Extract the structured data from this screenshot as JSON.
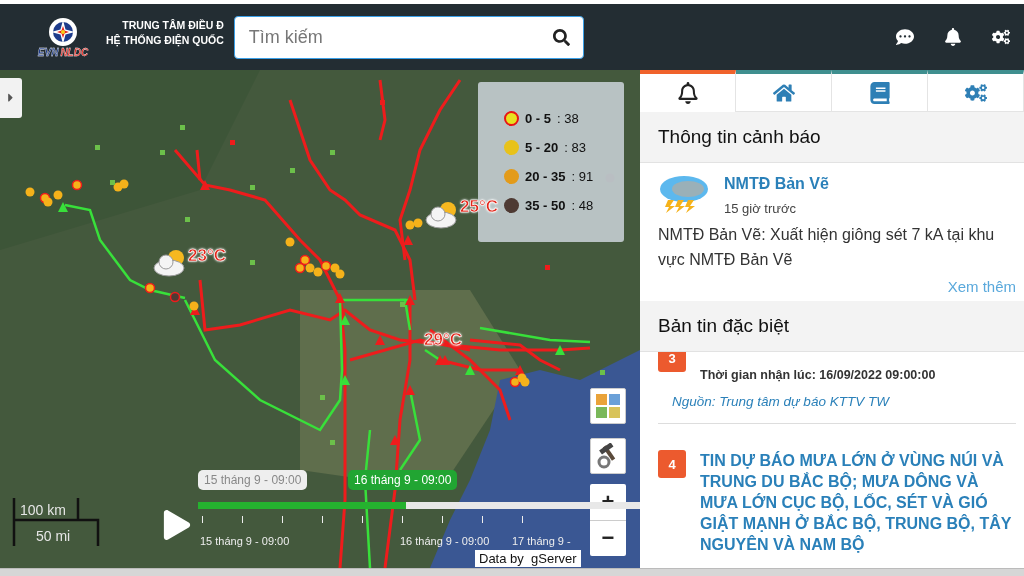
{
  "header": {
    "logo": {
      "primary": "EVN",
      "secondary": "NLDC"
    },
    "org_lines": [
      "TRUNG TÂM ĐIỀU Đ",
      "HỆ THỐNG ĐIỆN QUỐC"
    ],
    "search": {
      "placeholder": "Tìm kiếm"
    },
    "actions": [
      {
        "kind": "chat"
      },
      {
        "kind": "bell"
      },
      {
        "kind": "settings"
      }
    ]
  },
  "map": {
    "legend": [
      {
        "range": "0 - 5",
        "count": ": 38",
        "color": "#e8e020",
        "ring": true
      },
      {
        "range": "5 - 20",
        "count": ": 83",
        "color": "#e8c21a",
        "ring": false
      },
      {
        "range": "20 - 35",
        "count": ": 91",
        "color": "#e39b1a",
        "ring": false
      },
      {
        "range": "35 - 50",
        "count": ": 48",
        "color": "#4e3a33",
        "ring": false
      }
    ],
    "weather_markers": [
      {
        "temp": "23°C"
      },
      {
        "temp": "25°C"
      },
      {
        "temp": "29°C"
      }
    ],
    "timeline": {
      "start_label": "15 tháng 9 - 09:00",
      "current_label": "16 tháng 9 - 09:00",
      "level": 0.47,
      "ticks": [
        "15 tháng 9 - 09:00",
        "16 tháng 9 - 09:00",
        "17 tháng 9 -"
      ]
    },
    "scale": [
      "100 km",
      "50 mi"
    ],
    "zoom": [
      "+",
      "−"
    ],
    "attribution": "Data by  gServer"
  },
  "panel": {
    "tabs": [
      {
        "kind": "bell",
        "selected": true
      },
      {
        "kind": "home",
        "selected": false
      },
      {
        "kind": "book",
        "selected": false
      },
      {
        "kind": "settings",
        "selected": false
      }
    ],
    "alerts_title": "Thông tin cảnh báo",
    "alert": {
      "title": "NMTĐ Bản Vẽ",
      "time": "15 giờ trước",
      "body": "NMTĐ Bản Vẽ: Xuất hiện giông sét 7 kA tại khu vực NMTĐ Bản Vẽ",
      "more": "Xem thêm"
    },
    "news_title": "Bản tin đặc biệt",
    "news": [
      {
        "number": "3",
        "received": "Thời gian nhận lúc: 16/09/2022 09:00:00",
        "source": "Nguồn: Trung tâm dự báo KTTV TW"
      },
      {
        "number": "4",
        "title": "TIN DỰ BÁO MƯA LỚN Ở VÙNG NÚI VÀ TRUNG DU BẮC BỘ; MƯA DÔNG VÀ MƯA LỚN CỤC BỘ, LỐC, SÉT VÀ GIÓ GIẬT MẠNH Ở BẮC BỘ, TRUNG BỘ, TÂY NGUYÊN VÀ NAM BỘ"
      }
    ]
  }
}
